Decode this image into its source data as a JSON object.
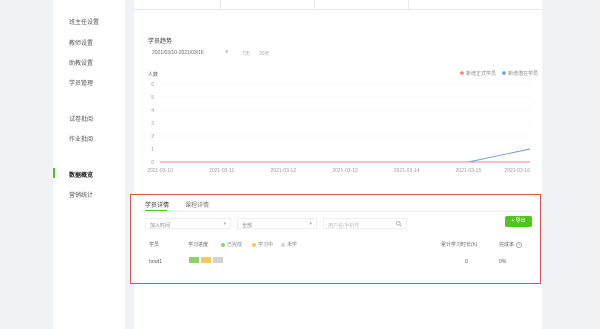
{
  "sidebar": {
    "items": [
      {
        "label": "班主任设置"
      },
      {
        "label": "教师设置"
      },
      {
        "label": "助教设置"
      },
      {
        "label": "学员管理"
      },
      {
        "label": "试卷批阅"
      },
      {
        "label": "作业批阅"
      },
      {
        "label": "数据概览"
      },
      {
        "label": "营销统计"
      }
    ],
    "active_index": 6
  },
  "trend": {
    "title": "学员趋势",
    "date_range": "2021/03/10-2021/03/16",
    "quick_links": [
      "7天",
      "30天"
    ],
    "legend": [
      {
        "label": "新增正式学员",
        "color": "#f08080"
      },
      {
        "label": "新增潜在学员",
        "color": "#6b9ae8"
      }
    ]
  },
  "chart_data": {
    "type": "line",
    "title": "",
    "ylabel": "人数",
    "xlabel": "",
    "ylim": [
      0,
      6
    ],
    "y_ticks": [
      "6",
      "5",
      "4",
      "3",
      "2",
      "1",
      "0"
    ],
    "x": [
      "2021-03-10",
      "2021-03-11",
      "2021-03-12",
      "2021-03-13",
      "2021-03-14",
      "2021-03-15",
      "2021-03-16"
    ],
    "series": [
      {
        "name": "新增潜在学员",
        "color": "#6b9ae8",
        "values": [
          0,
          0,
          0,
          0,
          0,
          0,
          1
        ]
      },
      {
        "name": "新增正式学员",
        "color": "#f08080",
        "values": [
          0,
          0,
          0,
          0,
          0,
          0,
          0
        ]
      }
    ],
    "grid": true,
    "legend_position": "top-right"
  },
  "details": {
    "tabs": [
      "学员详情",
      "课程详情"
    ],
    "active_tab": 0,
    "filter_class": "加入时间",
    "filter_status": "全部",
    "search_placeholder": "用户名/手机号",
    "export_label": "+ 导出",
    "columns": {
      "student": "学员",
      "progress": "学习进度",
      "total_time": "累计学习时长(h)",
      "rate": "完成率"
    },
    "progress_legend": [
      {
        "label": "已完成",
        "color": "#8fd16a"
      },
      {
        "label": "学习中",
        "color": "#f7c85c"
      },
      {
        "label": "未学",
        "color": "#d4d4d4"
      }
    ],
    "rows": [
      {
        "name": "hcwt1",
        "progress_colors": [
          "#8fd16a",
          "#f7c85c",
          "#d4d4d4"
        ],
        "total_time": "0",
        "rate": "0%"
      }
    ]
  }
}
